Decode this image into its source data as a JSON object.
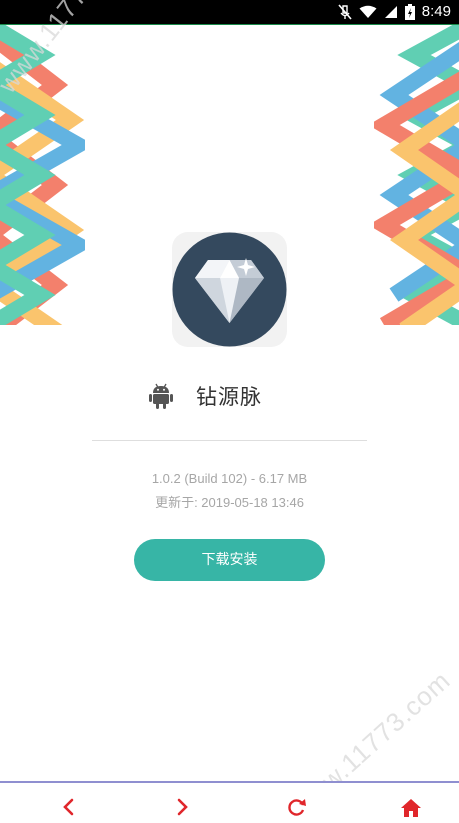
{
  "status_bar": {
    "time": "8:49",
    "icons": [
      "mute-icon",
      "wifi-icon",
      "signal-icon",
      "battery-icon"
    ]
  },
  "watermark": {
    "top": "www.11773.com",
    "bottom": "www.11773.com"
  },
  "app": {
    "name": "钻源脉",
    "platform_icon": "android-icon",
    "version_line": "1.0.2 (Build 102) - 6.17 MB",
    "updated_line": "更新于: 2019-05-18 13:46",
    "install_label": "下载安装"
  },
  "bottom_nav": {
    "items": [
      "back-icon",
      "forward-icon",
      "refresh-icon",
      "home-icon"
    ],
    "accent": "#e0262b"
  },
  "colors": {
    "button": "#37b5a6",
    "icon_bg": "#34495e",
    "deco": [
      "#f0563b",
      "#f9b13d",
      "#2e9ad8",
      "#2bbf9a"
    ]
  }
}
